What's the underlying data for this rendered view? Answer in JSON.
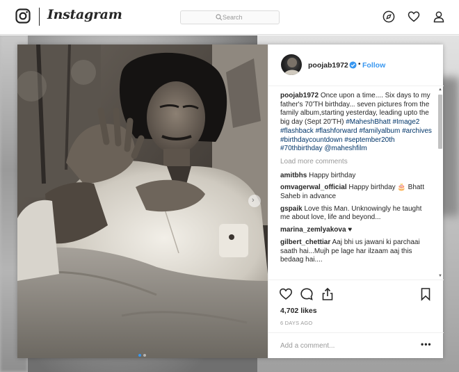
{
  "nav": {
    "wordmark": "Instagram",
    "search_placeholder": "Search",
    "icons": [
      "instagram-logo-icon",
      "compass-icon",
      "heart-icon",
      "profile-icon"
    ]
  },
  "post": {
    "username": "poojab1972",
    "bullet": "•",
    "follow_label": "Follow",
    "caption_user": "poojab1972",
    "caption_text": "Once upon a time.... Six days to my father's 70'TH birthday... seven pictures from the family album,starting yesterday, leading upto the big day (Sept 20'TH) ",
    "caption_tags": "#MaheshBhatt #Image2 #flashback #flashforward #familyalbum #archives #birthdaycountdown #september20th #70thbirthday @maheshfilm",
    "load_more": "Load more comments",
    "comments": [
      {
        "user": "amitbhs",
        "text": "Happy birthday"
      },
      {
        "user": "omvagerwal_official",
        "text": "Happy birthday 🎂 Bhatt Saheb in advance"
      },
      {
        "user": "gspaik",
        "text": "Love this Man. Unknowingly he taught me about love, life and beyond..."
      },
      {
        "user": "marina_zemlyakova",
        "text": "♥"
      },
      {
        "user": "gilbert_chettiar",
        "text": "Aaj bhi us jawani ki parchaai saath hai...Mujh pe lage har ilzaam aaj this bedaag hai...."
      }
    ],
    "likes": "4,702 likes",
    "time_ago": "6 DAYS AGO",
    "comment_placeholder": "Add a comment...",
    "more_label": "•••",
    "carousel": {
      "total": 2,
      "active": 0
    }
  },
  "colors": {
    "link": "#3897f0",
    "hashtag": "#003569",
    "text": "#262626",
    "muted": "#999999"
  }
}
